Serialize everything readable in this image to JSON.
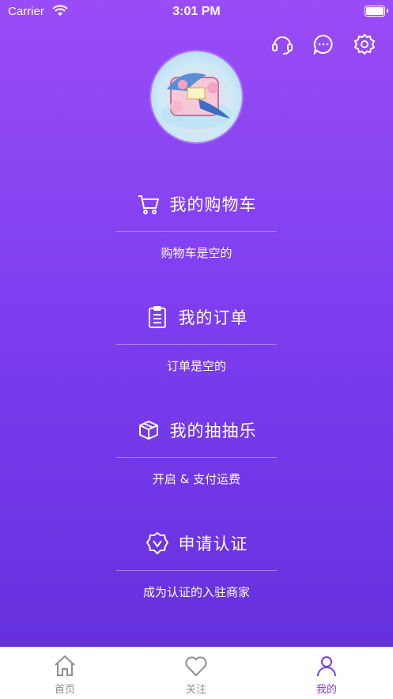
{
  "status_bar": {
    "carrier": "Carrier",
    "time": "3:01 PM"
  },
  "header_icons": [
    "customer-service-icon",
    "message-icon",
    "settings-icon"
  ],
  "sections": [
    {
      "title": "我的购物车",
      "subtitle": "购物车是空的",
      "icon": "cart-icon"
    },
    {
      "title": "我的订单",
      "subtitle": "订单是空的",
      "icon": "clipboard-icon"
    },
    {
      "title": "我的抽抽乐",
      "subtitle": "开启 & 支付运费",
      "icon": "box-icon"
    },
    {
      "title": "申请认证",
      "subtitle": "成为认证的入驻商家",
      "icon": "badge-icon"
    }
  ],
  "tabs": [
    {
      "label": "首页",
      "icon": "home-icon",
      "active": false
    },
    {
      "label": "关注",
      "icon": "heart-icon",
      "active": false
    },
    {
      "label": "我的",
      "icon": "person-icon",
      "active": true
    }
  ],
  "colors": {
    "gradient_top": "#9a4cf6",
    "gradient_bottom": "#6530dd",
    "active_tab": "#7b3df0",
    "inactive_tab": "#8e8e8e"
  }
}
